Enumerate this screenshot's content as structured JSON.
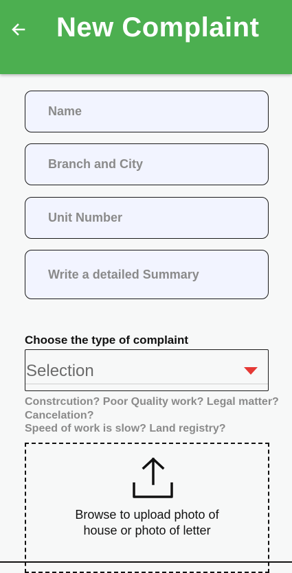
{
  "appbar": {
    "title": "New Complaint",
    "back_icon": "arrow-left-icon",
    "color": "#4caf50"
  },
  "form": {
    "name_placeholder": "Name",
    "branch_placeholder": "Branch and City",
    "unit_placeholder": "Unit Number",
    "summary_placeholder": "Write a detailed Summary",
    "complaint_type_label": "Choose the type of complaint",
    "complaint_type_value": "Selection",
    "dropdown_icon": "triangle-down-icon",
    "hint_line1": "Constrcution? Poor Quality work? Legal matter?",
    "hint_line2": "Cancelation?",
    "hint_line3": "Speed of work is slow? Land registry?"
  },
  "upload": {
    "icon": "upload-icon",
    "line1": "Browse to upload photo of",
    "line2": "house or photo of letter"
  }
}
